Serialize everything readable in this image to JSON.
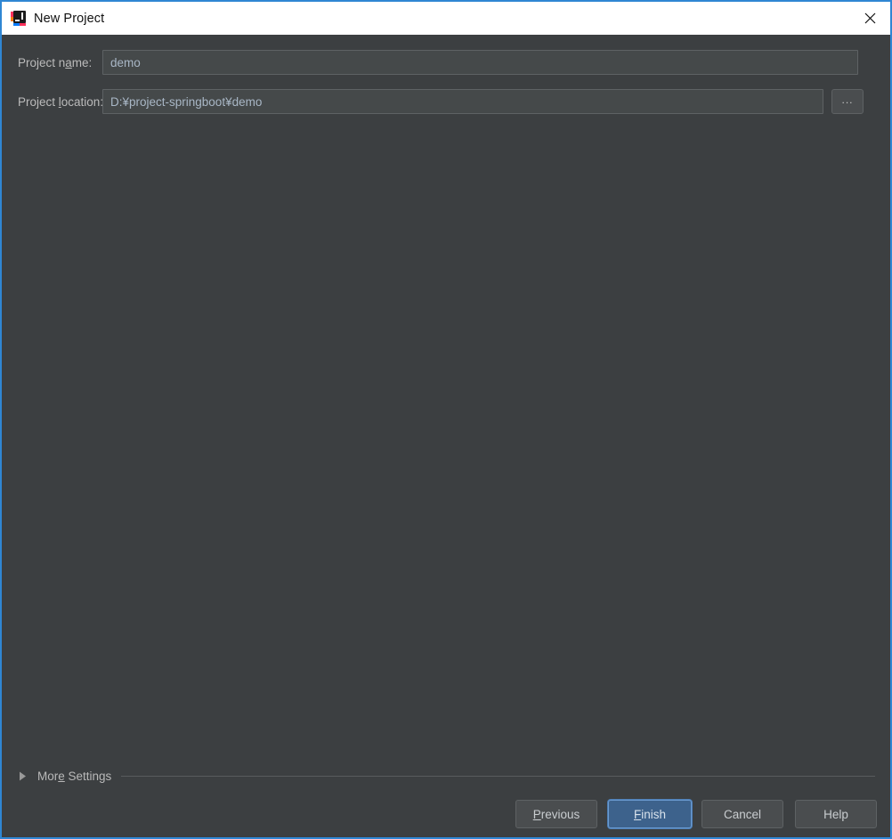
{
  "window": {
    "title": "New Project",
    "app_icon": "intellij-idea-icon",
    "close_icon": "close-icon",
    "accent_border_color": "#2f86d3",
    "body_background": "#3c3f41"
  },
  "form": {
    "project_name": {
      "label_before": "Project n",
      "label_mnemonic": "a",
      "label_after": "me:",
      "value": "demo",
      "placeholder": ""
    },
    "project_location": {
      "label_before": "Project ",
      "label_mnemonic": "l",
      "label_after": "ocation:",
      "value": "D:¥project-springboot¥demo",
      "placeholder": "",
      "browse_label": "...",
      "browse_icon": "ellipsis-icon"
    }
  },
  "more_settings": {
    "label_before": "Mor",
    "label_mnemonic": "e",
    "label_after": " Settings",
    "expanded": false,
    "disclosure_icon": "triangle-right-icon"
  },
  "footer": {
    "buttons": [
      {
        "name": "previous",
        "before": "",
        "mnemonic": "P",
        "after": "revious",
        "default": false
      },
      {
        "name": "finish",
        "before": "",
        "mnemonic": "F",
        "after": "inish",
        "default": true
      },
      {
        "name": "cancel",
        "before": "Cancel",
        "mnemonic": "",
        "after": "",
        "default": false
      },
      {
        "name": "help",
        "before": "Help",
        "mnemonic": "",
        "after": "",
        "default": false
      }
    ],
    "default_button_color": "#3d628c"
  }
}
